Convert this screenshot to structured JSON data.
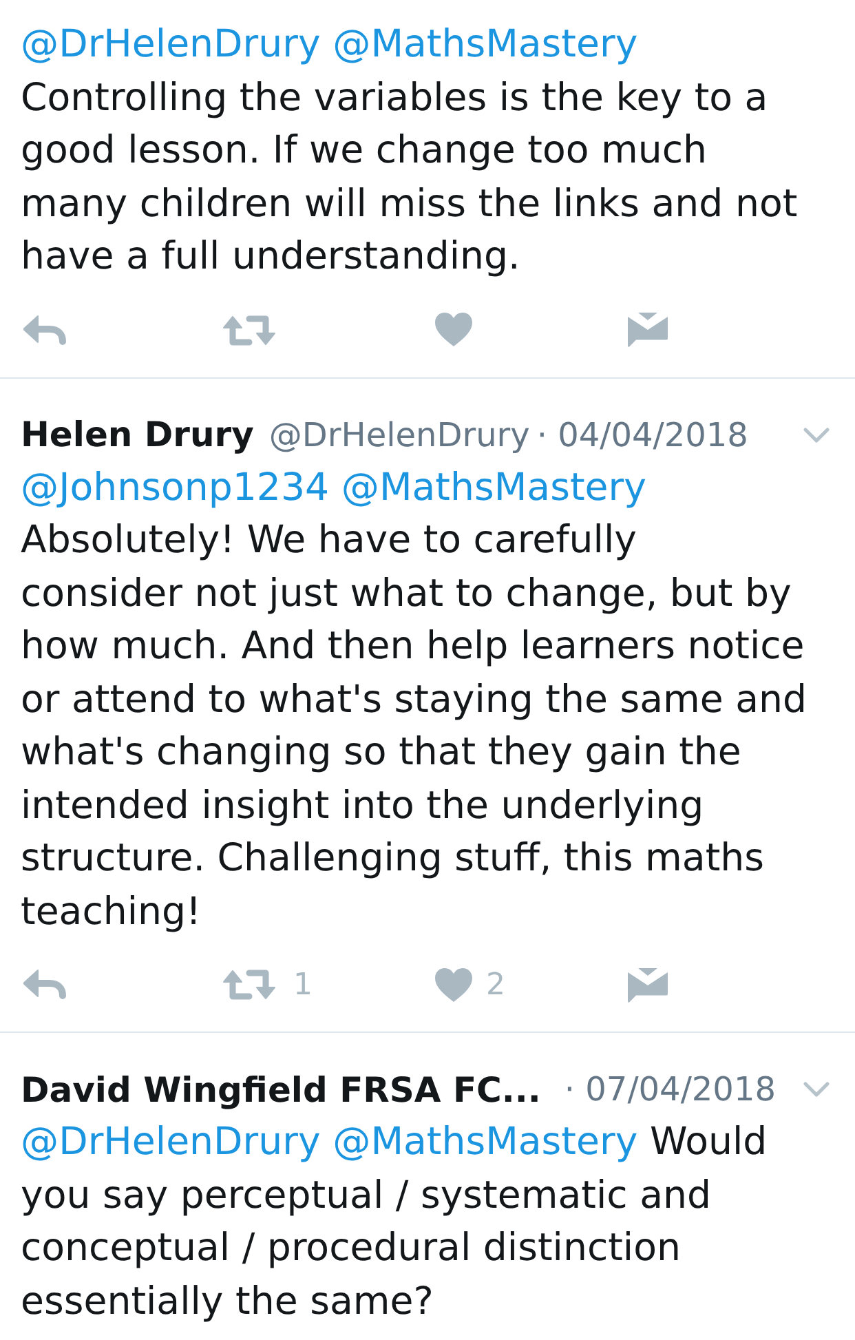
{
  "tweets": [
    {
      "body": [
        {
          "kind": "mention",
          "text": "@DrHelenDrury"
        },
        {
          "kind": "mention",
          "text": "@MathsMastery"
        },
        {
          "kind": "text",
          "text": "Controlling the variables is the key to a good lesson. If we change too much many children will miss the links and not have a full understanding."
        }
      ],
      "actions": [
        {
          "kind": "reply"
        },
        {
          "kind": "retweet"
        },
        {
          "kind": "like"
        },
        {
          "kind": "message"
        }
      ]
    },
    {
      "author": "Helen Drury",
      "handle": "@DrHelenDrury",
      "date": "· 04/04/2018",
      "body": [
        {
          "kind": "mention",
          "text": "@Johnsonp1234"
        },
        {
          "kind": "mention",
          "text": "@MathsMastery"
        },
        {
          "kind": "text",
          "text": "Absolutely! We have to carefully consider not just what to change, but by how much. And then help learners notice or attend to what's staying the same and what's changing so that they gain the intended insight into the underlying structure. Challenging stuff, this maths teaching!"
        }
      ],
      "actions": [
        {
          "kind": "reply"
        },
        {
          "kind": "retweet",
          "count": "1"
        },
        {
          "kind": "like",
          "count": "2"
        },
        {
          "kind": "message"
        }
      ]
    },
    {
      "author": "David Wingfield FRSA FC...",
      "date": "· 07/04/2018",
      "body": [
        {
          "kind": "mention",
          "text": "@DrHelenDrury"
        },
        {
          "kind": "mention",
          "text": "@MathsMastery"
        },
        {
          "kind": "text",
          "text": "Would you say perceptual / systematic and conceptual / procedural distinction essentially the same?"
        }
      ]
    }
  ]
}
